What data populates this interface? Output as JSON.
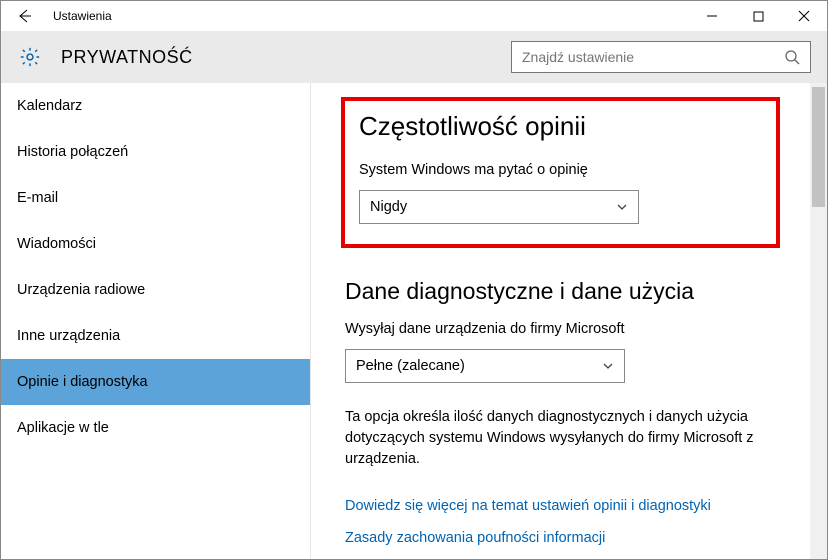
{
  "window": {
    "title": "Ustawienia"
  },
  "header": {
    "category": "PRYWATNOŚĆ",
    "search_placeholder": "Znajdź ustawienie"
  },
  "sidebar": {
    "items": [
      {
        "label": "Kalendarz",
        "selected": false
      },
      {
        "label": "Historia połączeń",
        "selected": false
      },
      {
        "label": "E-mail",
        "selected": false
      },
      {
        "label": "Wiadomości",
        "selected": false
      },
      {
        "label": "Urządzenia radiowe",
        "selected": false
      },
      {
        "label": "Inne urządzenia",
        "selected": false
      },
      {
        "label": "Opinie i diagnostyka",
        "selected": true
      },
      {
        "label": "Aplikacje w tle",
        "selected": false
      }
    ]
  },
  "main": {
    "feedback": {
      "heading": "Częstotliwość opinii",
      "label": "System Windows ma pytać o opinię",
      "selected": "Nigdy"
    },
    "diagnostics": {
      "heading": "Dane diagnostyczne i dane użycia",
      "label": "Wysyłaj dane urządzenia do firmy Microsoft",
      "selected": "Pełne (zalecane)",
      "description": "Ta opcja określa ilość danych diagnostycznych i danych użycia dotyczących systemu Windows wysyłanych do firmy Microsoft z urządzenia."
    },
    "links": {
      "learn_more": "Dowiedz się więcej na temat ustawień opinii i diagnostyki",
      "behavior": "Zasady zachowania poufności informacji"
    }
  }
}
